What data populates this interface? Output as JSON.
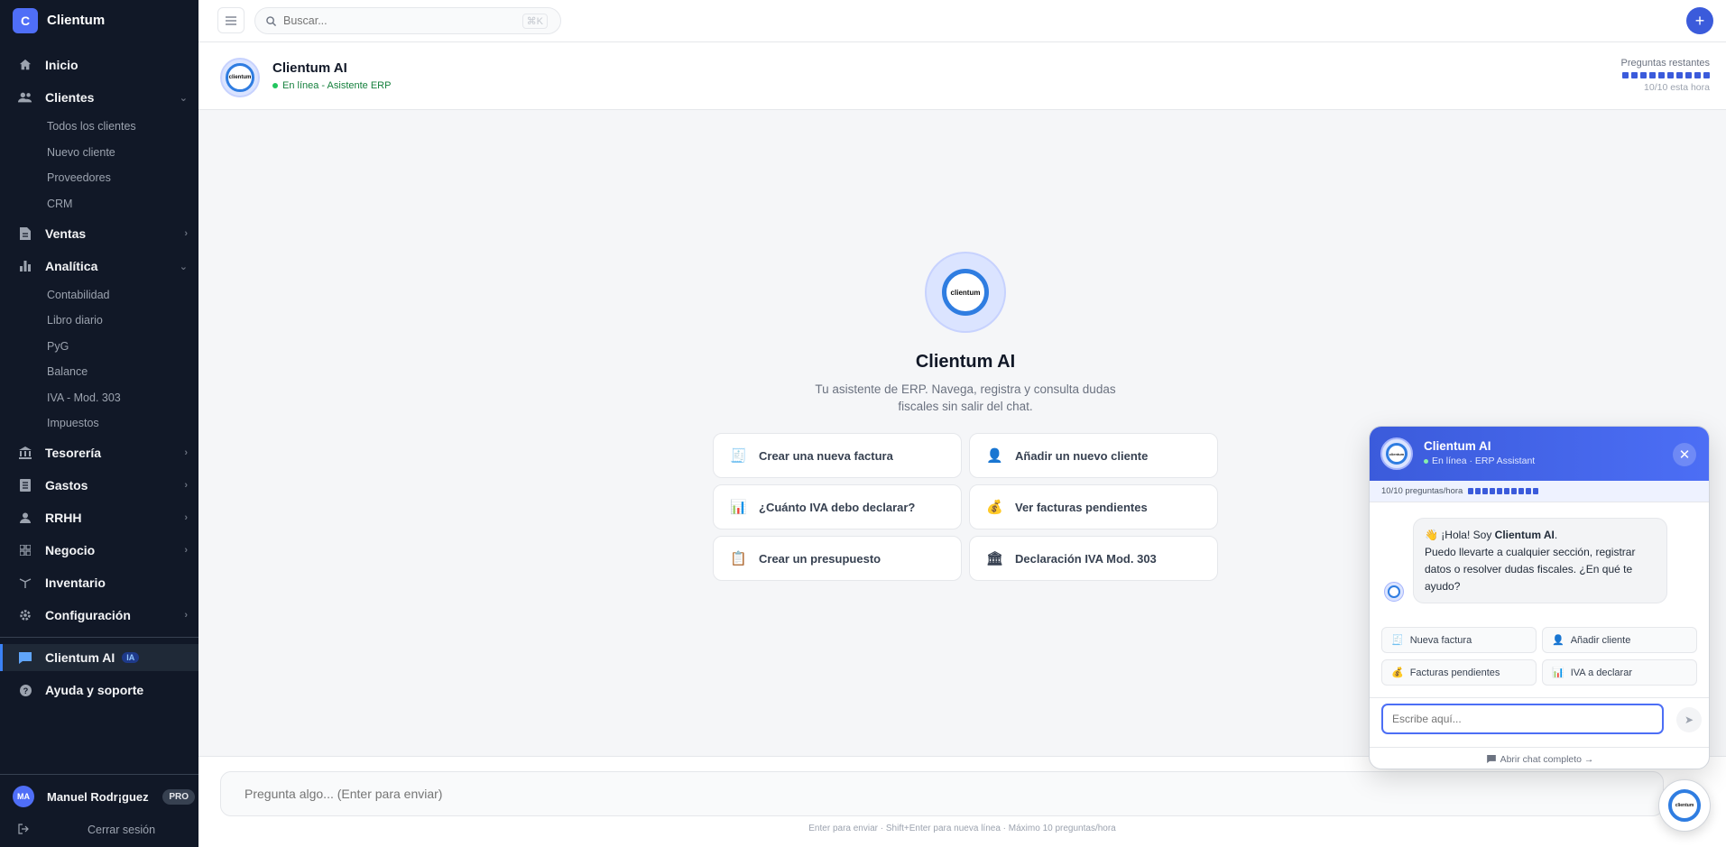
{
  "brand": {
    "initial": "C",
    "name": "Clientum"
  },
  "sidebar": {
    "inicio": "Inicio",
    "clientes": "Clientes",
    "clientes_sub": [
      "Todos los clientes",
      "Nuevo cliente",
      "Proveedores",
      "CRM"
    ],
    "ventas": "Ventas",
    "analitica": "Analítica",
    "analitica_sub": [
      "Contabilidad",
      "Libro diario",
      "PyG",
      "Balance",
      "IVA - Mod. 303",
      "Impuestos"
    ],
    "tesoreria": "Tesorería",
    "gastos": "Gastos",
    "rrhh": "RRHH",
    "negocio": "Negocio",
    "inventario": "Inventario",
    "configuracion": "Configuración",
    "ai": "Clientum AI",
    "ai_badge": "IA",
    "ayuda": "Ayuda y soporte"
  },
  "user": {
    "initials": "MA",
    "name": "Manuel Rodr¡guez",
    "plan": "PRO",
    "logout": "Cerrar sesión"
  },
  "topbar": {
    "search_placeholder": "Buscar...",
    "shortcut": "⌘K",
    "add": "+"
  },
  "chat_header": {
    "title": "Clientum AI",
    "status": "En línea - Asistente ERP",
    "quota_label": "Preguntas restantes",
    "quota_count": "10/10 esta hora",
    "quota_used": 10,
    "quota_total": 10
  },
  "logo_text": "clientum",
  "hero": {
    "title": "Clientum AI",
    "subtitle": "Tu asistente de ERP. Navega, registra y consulta dudas fiscales sin salir del chat."
  },
  "suggestions": [
    {
      "icon": "🧾",
      "label": "Crear una nueva factura"
    },
    {
      "icon": "👤",
      "label": "Añadir un nuevo cliente"
    },
    {
      "icon": "📊",
      "label": "¿Cuánto IVA debo declarar?"
    },
    {
      "icon": "💰",
      "label": "Ver facturas pendientes"
    },
    {
      "icon": "📋",
      "label": "Crear un presupuesto"
    },
    {
      "icon": "🏛",
      "label": "Declaración IVA Mod. 303"
    }
  ],
  "bottom": {
    "placeholder": "Pregunta algo... (Enter para enviar)",
    "hint": "Enter para enviar · Shift+Enter para nueva línea · Máximo 10 preguntas/hora"
  },
  "widget": {
    "title": "Clientum AI",
    "status": "En línea · ERP Assistant",
    "close": "✕",
    "quota": "10/10 preguntas/hora",
    "greeting_emoji": "👋",
    "greeting_pre": "¡Hola! Soy",
    "greeting_name": "Clientum AI",
    "greeting_dot": ".",
    "greeting_body": "Puedo llevarte a cualquier sección, registrar datos o resolver dudas fiscales. ¿En qué te ayudo?",
    "chips": [
      {
        "icon": "🧾",
        "label": "Nueva factura"
      },
      {
        "icon": "👤",
        "label": "Añadir cliente"
      },
      {
        "icon": "💰",
        "label": "Facturas pendientes"
      },
      {
        "icon": "📊",
        "label": "IVA a declarar"
      }
    ],
    "input_placeholder": "Escribe aquí...",
    "send": "➤",
    "footer": "Abrir chat completo →"
  },
  "colors": {
    "accent": "#3b5bdb",
    "sidebar_bg": "#111827",
    "online": "#22c55e",
    "logo_ring": "#2f7de1"
  }
}
